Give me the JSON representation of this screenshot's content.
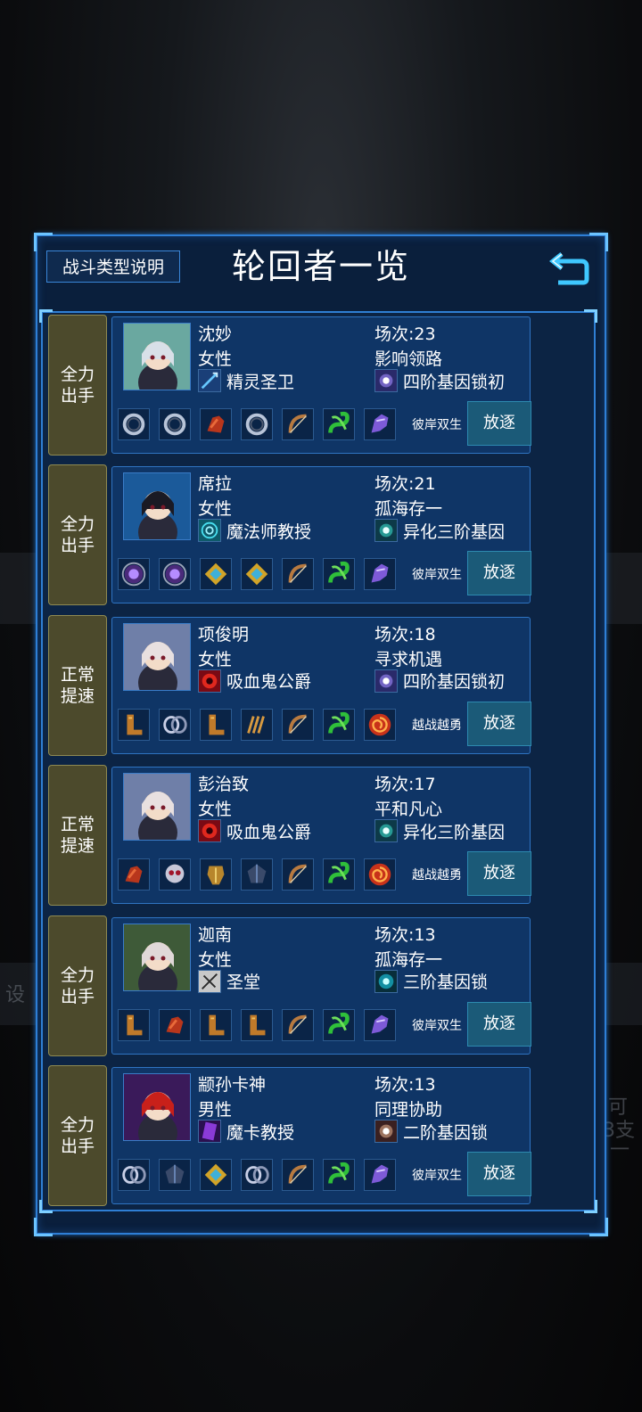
{
  "header": {
    "type_button": "战斗类型说明",
    "title": "轮回者一览",
    "back_icon": "back-arrow-icon"
  },
  "background": {
    "left_char": "设",
    "right_text_1": "可",
    "right_text_2": "3支",
    "right_text_3": "一"
  },
  "colors": {
    "panel": "#0f3566",
    "frame": "#2e7fd6",
    "badge": "#4c4a2c",
    "exile": "#1b5a78"
  },
  "characters": [
    {
      "badge": [
        "全力",
        "出手"
      ],
      "name": "沈妙",
      "gender": "女性",
      "class": "精灵圣卫",
      "class_icon": "spear-icon",
      "count": "场次:23",
      "trait": "影响领路",
      "gene": "四阶基因锁初",
      "gene_icon": "purple-star-icon",
      "equipment": [
        "ring-icon",
        "ring-icon",
        "glove-icon",
        "ring-icon",
        "bow-icon",
        "green-snake-icon",
        "purple-beast-icon"
      ],
      "talent": "彼岸双生",
      "exile": "放逐"
    },
    {
      "badge": [
        "全力",
        "出手"
      ],
      "name": "席拉",
      "gender": "女性",
      "class": "魔法师教授",
      "class_icon": "vortex-icon",
      "count": "场次:21",
      "trait": "孤海存一",
      "gene": "异化三阶基因",
      "gene_icon": "teal-star-icon",
      "equipment": [
        "purple-orb-icon",
        "purple-orb-icon",
        "gold-gem-icon",
        "gold-gem-icon",
        "bow-icon",
        "green-snake-icon",
        "purple-beast-icon"
      ],
      "talent": "彼岸双生",
      "exile": "放逐"
    },
    {
      "badge": [
        "正常",
        "提速"
      ],
      "name": "项俊明",
      "gender": "女性",
      "class": "吸血鬼公爵",
      "class_icon": "red-eye-icon",
      "count": "场次:18",
      "trait": "寻求机遇",
      "gene": "四阶基因锁初",
      "gene_icon": "purple-star-icon",
      "equipment": [
        "boots-icon",
        "silver-ring-icon",
        "boots-icon",
        "gold-claw-icon",
        "bow-icon",
        "green-snake-icon"
      ],
      "talent_icon": "red-swirl-icon",
      "talent": "越战越勇",
      "exile": "放逐"
    },
    {
      "badge": [
        "正常",
        "提速"
      ],
      "name": "彭治致",
      "gender": "女性",
      "class": "吸血鬼公爵",
      "class_icon": "red-eye-icon",
      "count": "场次:17",
      "trait": "平和凡心",
      "gene": "异化三阶基因",
      "gene_icon": "teal-star-icon",
      "equipment": [
        "glove-icon",
        "skull-mask-icon",
        "golden-armor-icon",
        "dark-gem-icon",
        "bow-icon",
        "green-snake-icon"
      ],
      "talent_icon": "red-swirl-icon",
      "talent": "越战越勇",
      "exile": "放逐"
    },
    {
      "badge": [
        "全力",
        "出手"
      ],
      "name": "迦南",
      "gender": "女性",
      "class": "圣堂",
      "class_icon": "crossbow-icon",
      "count": "场次:13",
      "trait": "孤海存一",
      "gene": "三阶基因锁",
      "gene_icon": "cyan-star-icon",
      "equipment": [
        "boots-icon",
        "glove-icon",
        "boots-icon",
        "boots-icon",
        "bow-icon",
        "green-snake-icon",
        "purple-beast-icon"
      ],
      "talent": "彼岸双生",
      "exile": "放逐"
    },
    {
      "badge": [
        "全力",
        "出手"
      ],
      "name": "颛孙卡神",
      "gender": "男性",
      "class": "魔卡教授",
      "class_icon": "purple-card-icon",
      "count": "场次:13",
      "trait": "同理协助",
      "gene": "二阶基因锁",
      "gene_icon": "white-star-icon",
      "equipment": [
        "silver-ring-icon",
        "dark-gem-icon",
        "gold-gem-icon",
        "silver-ring-icon",
        "bow-icon",
        "green-snake-icon",
        "purple-beast-icon"
      ],
      "talent": "彼岸双生",
      "exile": "放逐"
    }
  ]
}
